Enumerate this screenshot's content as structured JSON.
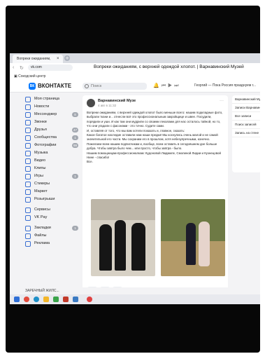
{
  "browser": {
    "tab_label": "Вопреки ожиданиям,",
    "tab_close": "×",
    "new_tab": "+",
    "url": "vk.com",
    "page_title": "Вопреки ожиданиям, с верхней одеждой хлопот. | Варнавинский Музей",
    "bookmark": "Сокодский центр"
  },
  "header": {
    "logo_text": "ВК",
    "brand": "ВКОНТАКТЕ",
    "search_placeholder": "Поиск",
    "now_playing": "Георгий — Пока Россия празднуем г..."
  },
  "sidebar": {
    "items": [
      {
        "label": "Моя страница",
        "badge": ""
      },
      {
        "label": "Новости",
        "badge": ""
      },
      {
        "label": "Мессенджер",
        "badge": "8"
      },
      {
        "label": "Звонки",
        "badge": ""
      },
      {
        "label": "Друзья",
        "badge": "47"
      },
      {
        "label": "Сообщества",
        "badge": "1"
      },
      {
        "label": "Фотографии",
        "badge": "99"
      },
      {
        "label": "Музыка",
        "badge": ""
      },
      {
        "label": "Видео",
        "badge": ""
      },
      {
        "label": "Клипы",
        "badge": ""
      },
      {
        "label": "Игры",
        "badge": "1"
      },
      {
        "label": "Стикеры",
        "badge": ""
      },
      {
        "label": "Маркет",
        "badge": ""
      },
      {
        "label": "Розыгрыши",
        "badge": ""
      }
    ],
    "items2": [
      {
        "label": "Сервисы",
        "badge": ""
      },
      {
        "label": "VK Pay",
        "badge": ""
      }
    ],
    "items3": [
      {
        "label": "Закладки",
        "badge": "1"
      },
      {
        "label": "Файлы",
        "badge": ""
      },
      {
        "label": "Реклама",
        "badge": ""
      }
    ]
  },
  "post": {
    "author": "Варнавинский Музе",
    "date": "4 авг в 11:32",
    "menu": "···",
    "paragraphs": [
      "Вопреки ожиданиям, с верхней одеждой хлопот было меньше всего: нашим подкладные фото, выбрали ткани и... отнесли всё это профессиональным закройщице и швее. Посудили, порядили и уши. И как там они мудрили со своими лекалами для нас осталось тайной, но то, что они угадали с фасонами - это точно. Судите сами.",
      "И, оставляя от того, что мы вам хотели показать и, главное, сказать:",
      "Какое богатое наследие оставили нам наши предки! Мы коснулись очень малой и не самой значительной его части. Мы сохраним его в прошлом, хотя небезупречными, конечно. Пожелаем всем нашим подписчикам и, вообще, всем оставить в сегодняшнем дне больше добра. Чтобы завтра было чем... или просто, чтобы завтра - было.",
      "Нашим помощницам-профессионалкам: Кудоновой Людмиле, Смолиной Лидии и Кузнецовой Нине - спасибо!",
      "Все."
    ]
  },
  "right_panel": {
    "items": [
      "Варнавинский Музей...",
      "Записи Варнавинск...",
      "Все записи",
      "Поиск записей",
      "Запись на стене"
    ]
  },
  "tray": {
    "text": "ЗАРЕЧНЫЙ ЖИЛС..."
  }
}
